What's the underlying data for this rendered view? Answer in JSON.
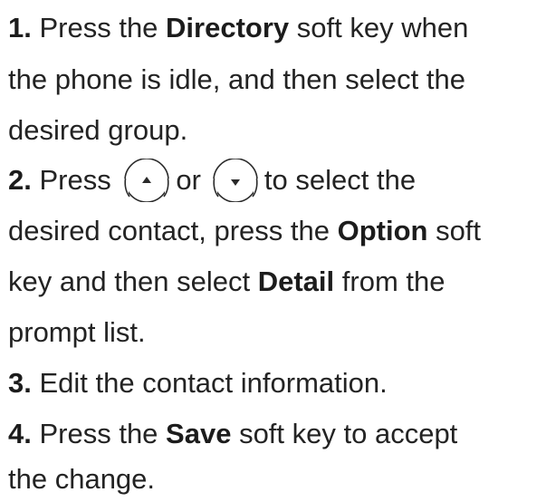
{
  "steps": [
    {
      "number": "1.",
      "text_before": " Press the ",
      "bold_1": "Directory",
      "text_after_1": " soft key when",
      "line_2": "the phone is idle, and then select the",
      "line_3": "desired group."
    },
    {
      "number": "2.",
      "text_before": " Press ",
      "or_text": "or",
      "text_after_keys": "to select the",
      "line_2_before": "desired contact, press the ",
      "bold_1": "Option",
      "line_2_after": " soft",
      "line_3_before": "key and then select ",
      "bold_2": "Detail",
      "line_3_after": " from the",
      "line_4": "prompt list.",
      "icons": [
        "up-arrow-key-icon",
        "down-arrow-key-icon"
      ]
    },
    {
      "number": "3.",
      "text": " Edit the contact information."
    },
    {
      "number": "4.",
      "text_before": " Press the ",
      "bold_1": "Save",
      "text_after_1": " soft key to accept",
      "line_2": "the change."
    }
  ]
}
